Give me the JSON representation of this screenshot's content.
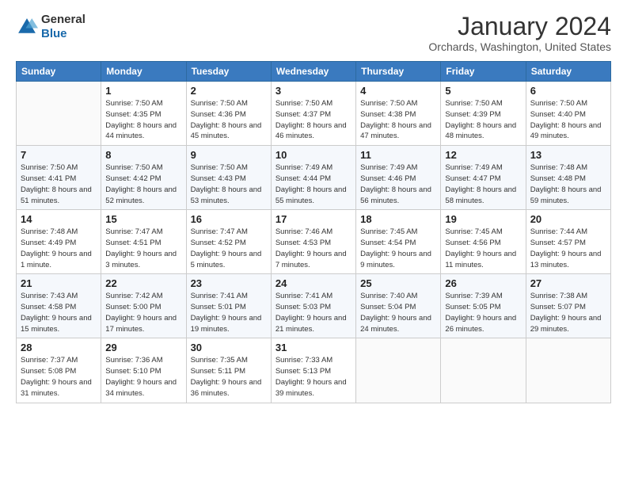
{
  "logo": {
    "line1": "General",
    "line2": "Blue"
  },
  "header": {
    "title": "January 2024",
    "subtitle": "Orchards, Washington, United States"
  },
  "weekdays": [
    "Sunday",
    "Monday",
    "Tuesday",
    "Wednesday",
    "Thursday",
    "Friday",
    "Saturday"
  ],
  "weeks": [
    [
      {
        "day": "",
        "sunrise": "",
        "sunset": "",
        "daylight": ""
      },
      {
        "day": "1",
        "sunrise": "7:50 AM",
        "sunset": "4:35 PM",
        "daylight": "8 hours and 44 minutes."
      },
      {
        "day": "2",
        "sunrise": "7:50 AM",
        "sunset": "4:36 PM",
        "daylight": "8 hours and 45 minutes."
      },
      {
        "day": "3",
        "sunrise": "7:50 AM",
        "sunset": "4:37 PM",
        "daylight": "8 hours and 46 minutes."
      },
      {
        "day": "4",
        "sunrise": "7:50 AM",
        "sunset": "4:38 PM",
        "daylight": "8 hours and 47 minutes."
      },
      {
        "day": "5",
        "sunrise": "7:50 AM",
        "sunset": "4:39 PM",
        "daylight": "8 hours and 48 minutes."
      },
      {
        "day": "6",
        "sunrise": "7:50 AM",
        "sunset": "4:40 PM",
        "daylight": "8 hours and 49 minutes."
      }
    ],
    [
      {
        "day": "7",
        "sunrise": "7:50 AM",
        "sunset": "4:41 PM",
        "daylight": "8 hours and 51 minutes."
      },
      {
        "day": "8",
        "sunrise": "7:50 AM",
        "sunset": "4:42 PM",
        "daylight": "8 hours and 52 minutes."
      },
      {
        "day": "9",
        "sunrise": "7:50 AM",
        "sunset": "4:43 PM",
        "daylight": "8 hours and 53 minutes."
      },
      {
        "day": "10",
        "sunrise": "7:49 AM",
        "sunset": "4:44 PM",
        "daylight": "8 hours and 55 minutes."
      },
      {
        "day": "11",
        "sunrise": "7:49 AM",
        "sunset": "4:46 PM",
        "daylight": "8 hours and 56 minutes."
      },
      {
        "day": "12",
        "sunrise": "7:49 AM",
        "sunset": "4:47 PM",
        "daylight": "8 hours and 58 minutes."
      },
      {
        "day": "13",
        "sunrise": "7:48 AM",
        "sunset": "4:48 PM",
        "daylight": "8 hours and 59 minutes."
      }
    ],
    [
      {
        "day": "14",
        "sunrise": "7:48 AM",
        "sunset": "4:49 PM",
        "daylight": "9 hours and 1 minute."
      },
      {
        "day": "15",
        "sunrise": "7:47 AM",
        "sunset": "4:51 PM",
        "daylight": "9 hours and 3 minutes."
      },
      {
        "day": "16",
        "sunrise": "7:47 AM",
        "sunset": "4:52 PM",
        "daylight": "9 hours and 5 minutes."
      },
      {
        "day": "17",
        "sunrise": "7:46 AM",
        "sunset": "4:53 PM",
        "daylight": "9 hours and 7 minutes."
      },
      {
        "day": "18",
        "sunrise": "7:45 AM",
        "sunset": "4:54 PM",
        "daylight": "9 hours and 9 minutes."
      },
      {
        "day": "19",
        "sunrise": "7:45 AM",
        "sunset": "4:56 PM",
        "daylight": "9 hours and 11 minutes."
      },
      {
        "day": "20",
        "sunrise": "7:44 AM",
        "sunset": "4:57 PM",
        "daylight": "9 hours and 13 minutes."
      }
    ],
    [
      {
        "day": "21",
        "sunrise": "7:43 AM",
        "sunset": "4:58 PM",
        "daylight": "9 hours and 15 minutes."
      },
      {
        "day": "22",
        "sunrise": "7:42 AM",
        "sunset": "5:00 PM",
        "daylight": "9 hours and 17 minutes."
      },
      {
        "day": "23",
        "sunrise": "7:41 AM",
        "sunset": "5:01 PM",
        "daylight": "9 hours and 19 minutes."
      },
      {
        "day": "24",
        "sunrise": "7:41 AM",
        "sunset": "5:03 PM",
        "daylight": "9 hours and 21 minutes."
      },
      {
        "day": "25",
        "sunrise": "7:40 AM",
        "sunset": "5:04 PM",
        "daylight": "9 hours and 24 minutes."
      },
      {
        "day": "26",
        "sunrise": "7:39 AM",
        "sunset": "5:05 PM",
        "daylight": "9 hours and 26 minutes."
      },
      {
        "day": "27",
        "sunrise": "7:38 AM",
        "sunset": "5:07 PM",
        "daylight": "9 hours and 29 minutes."
      }
    ],
    [
      {
        "day": "28",
        "sunrise": "7:37 AM",
        "sunset": "5:08 PM",
        "daylight": "9 hours and 31 minutes."
      },
      {
        "day": "29",
        "sunrise": "7:36 AM",
        "sunset": "5:10 PM",
        "daylight": "9 hours and 34 minutes."
      },
      {
        "day": "30",
        "sunrise": "7:35 AM",
        "sunset": "5:11 PM",
        "daylight": "9 hours and 36 minutes."
      },
      {
        "day": "31",
        "sunrise": "7:33 AM",
        "sunset": "5:13 PM",
        "daylight": "9 hours and 39 minutes."
      },
      {
        "day": "",
        "sunrise": "",
        "sunset": "",
        "daylight": ""
      },
      {
        "day": "",
        "sunrise": "",
        "sunset": "",
        "daylight": ""
      },
      {
        "day": "",
        "sunrise": "",
        "sunset": "",
        "daylight": ""
      }
    ]
  ],
  "labels": {
    "sunrise": "Sunrise:",
    "sunset": "Sunset:",
    "daylight": "Daylight:"
  }
}
